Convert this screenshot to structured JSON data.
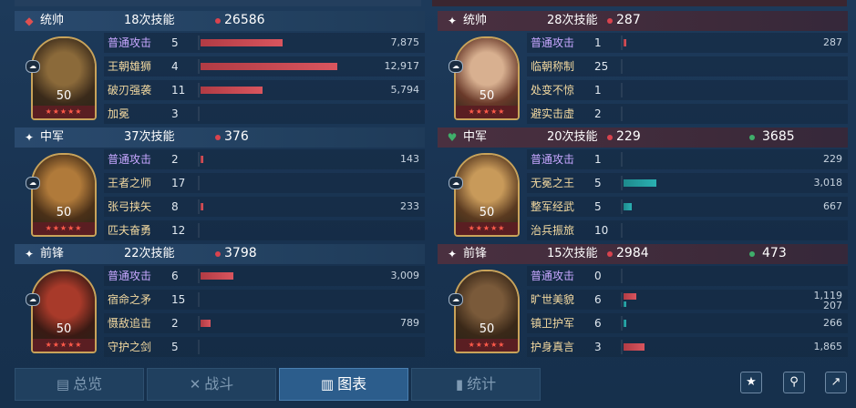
{
  "colors": {
    "accent_red": "#d9434e",
    "accent_green": "#3fae6a",
    "bar_red": "#c84650",
    "bar_teal": "#26a0a2",
    "basic_attack_purple": "#c7a7ff",
    "skill_gold": "#f3d9a0",
    "active_tab": "#2c5d8c"
  },
  "left": [
    {
      "role": "统帅",
      "role_icon": "diamond-icon",
      "count": "18次技能",
      "value": "26586",
      "level": "50",
      "stars": "★★★★★",
      "skills": [
        {
          "name": "普通攻击",
          "times": "5",
          "value": "7,875",
          "ratio": 0.6,
          "basic": true
        },
        {
          "name": "王朝雄狮",
          "times": "4",
          "value": "12,917",
          "ratio": 1.0
        },
        {
          "name": "破刃强袭",
          "times": "11",
          "value": "5,794",
          "ratio": 0.45
        },
        {
          "name": "加冕",
          "times": "3",
          "value": "",
          "ratio": 0
        }
      ]
    },
    {
      "role": "中军",
      "role_icon": "plus-icon",
      "count": "37次技能",
      "value": "376",
      "level": "50",
      "stars": "★★★★★",
      "skills": [
        {
          "name": "普通攻击",
          "times": "2",
          "value": "143",
          "ratio": 0.02,
          "basic": true
        },
        {
          "name": "王者之师",
          "times": "17",
          "value": "",
          "ratio": 0
        },
        {
          "name": "张弓挟矢",
          "times": "8",
          "value": "233",
          "ratio": 0.02
        },
        {
          "name": "匹夫奋勇",
          "times": "12",
          "value": "",
          "ratio": 0
        }
      ]
    },
    {
      "role": "前锋",
      "role_icon": "plus-icon",
      "count": "22次技能",
      "value": "3798",
      "level": "50",
      "stars": "★★★★★",
      "skills": [
        {
          "name": "普通攻击",
          "times": "6",
          "value": "3,009",
          "ratio": 0.24,
          "basic": true
        },
        {
          "name": "宿命之矛",
          "times": "15",
          "value": "",
          "ratio": 0
        },
        {
          "name": "慑敌追击",
          "times": "2",
          "value": "789",
          "ratio": 0.07
        },
        {
          "name": "守护之剑",
          "times": "5",
          "value": "",
          "ratio": 0
        }
      ]
    }
  ],
  "right": [
    {
      "role": "统帅",
      "role_icon": "plus-icon",
      "count": "28次技能",
      "value": "287",
      "value2": "",
      "level": "50",
      "stars": "★★★★★",
      "skills": [
        {
          "name": "普通攻击",
          "times": "1",
          "value": "287",
          "ratio": 0.02,
          "basic": true
        },
        {
          "name": "临朝称制",
          "times": "25",
          "value": "",
          "ratio": 0
        },
        {
          "name": "处变不惊",
          "times": "1",
          "value": "",
          "ratio": 0
        },
        {
          "name": "避实击虚",
          "times": "2",
          "value": "",
          "ratio": 0
        }
      ]
    },
    {
      "role": "中军",
      "role_icon": "heart-diamond-icon",
      "count": "20次技能",
      "value": "229",
      "value2": "3685",
      "level": "50",
      "stars": "★★★★★",
      "skills": [
        {
          "name": "普通攻击",
          "times": "1",
          "value": "229",
          "ratio": 0,
          "basic": true
        },
        {
          "name": "无冕之王",
          "times": "5",
          "value": "3,018",
          "ratio": 0.24,
          "teal": true
        },
        {
          "name": "整军经武",
          "times": "5",
          "value": "667",
          "ratio": 0.06,
          "teal": true
        },
        {
          "name": "治兵振旅",
          "times": "10",
          "value": "",
          "ratio": 0
        }
      ]
    },
    {
      "role": "前锋",
      "role_icon": "plus-icon",
      "count": "15次技能",
      "value": "2984",
      "value2": "473",
      "level": "50",
      "stars": "★★★★★",
      "skills": [
        {
          "name": "普通攻击",
          "times": "0",
          "value": "",
          "ratio": 0,
          "basic": true
        },
        {
          "name": "旷世美貌",
          "times": "6",
          "value": "1,119",
          "value2": "207",
          "ratio": 0.09,
          "ratio2": 0.02
        },
        {
          "name": "镇卫护军",
          "times": "6",
          "value": "266",
          "ratio": 0.02,
          "teal": true
        },
        {
          "name": "护身真言",
          "times": "3",
          "value": "1,865",
          "ratio": 0.15
        }
      ]
    }
  ],
  "tabs": [
    {
      "label": "总览",
      "icon": "document-icon",
      "active": false
    },
    {
      "label": "战斗",
      "icon": "crossed-swords-icon",
      "active": false
    },
    {
      "label": "图表",
      "icon": "chart-icon",
      "active": true
    },
    {
      "label": "统计",
      "icon": "bar-stats-icon",
      "active": false
    }
  ],
  "actions": [
    {
      "name": "star-button",
      "icon": "star-icon"
    },
    {
      "name": "location-button",
      "icon": "pin-icon"
    },
    {
      "name": "share-button",
      "icon": "share-icon"
    }
  ]
}
